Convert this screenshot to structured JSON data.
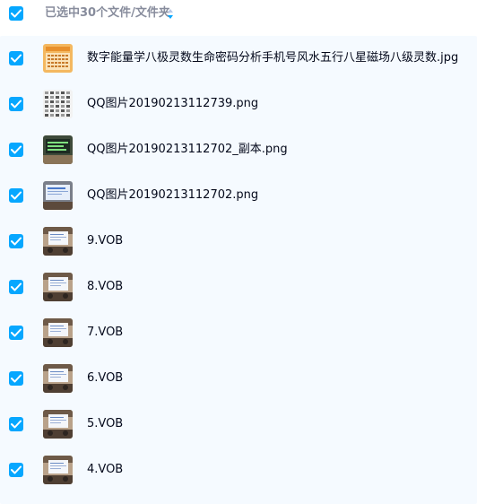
{
  "header": {
    "selection_label": "已选中30个文件/文件夹"
  },
  "files": [
    {
      "name": "数字能量学八极灵数生命密码分析手机号风水五行八星磁场八级灵数.jpg",
      "thumb": "calendar"
    },
    {
      "name": "QQ图片20190213112739.png",
      "thumb": "grid"
    },
    {
      "name": "QQ图片20190213112702_副本.png",
      "thumb": "green-screen"
    },
    {
      "name": "QQ图片20190213112702.png",
      "thumb": "screen"
    },
    {
      "name": "9.VOB",
      "thumb": "video"
    },
    {
      "name": "8.VOB",
      "thumb": "video"
    },
    {
      "name": "7.VOB",
      "thumb": "video"
    },
    {
      "name": "6.VOB",
      "thumb": "video"
    },
    {
      "name": "5.VOB",
      "thumb": "video"
    },
    {
      "name": "4.VOB",
      "thumb": "video"
    }
  ],
  "colors": {
    "accent": "#06a7ff",
    "list_background": "#f5faff",
    "text_primary": "#03081a",
    "text_muted": "#878c9c"
  }
}
